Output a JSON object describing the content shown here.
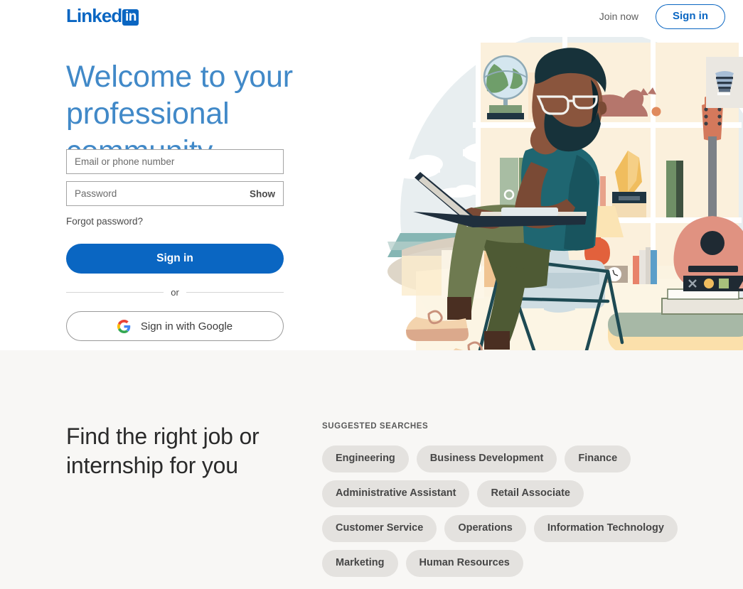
{
  "header": {
    "logo_text": "Linked",
    "logo_badge": "in",
    "join_now": "Join now",
    "sign_in": "Sign in"
  },
  "hero": {
    "headline_line1": "Welcome to your",
    "headline_line2": "professional community",
    "email": {
      "value": "",
      "placeholder": "Email or phone number"
    },
    "password": {
      "value": "",
      "placeholder": "Password",
      "show_label": "Show"
    },
    "forgot_password": "Forgot password?",
    "sign_in_button": "Sign in",
    "divider_label": "or",
    "google_button": "Sign in with Google",
    "illustration": {
      "name": "person-reading-at-laptop-illustration",
      "elements": [
        "globe",
        "books",
        "cat",
        "binders",
        "vase",
        "lamp",
        "clocks",
        "guitar",
        "armchair",
        "laptop",
        "framed-art",
        "sofa",
        "book-stack"
      ]
    }
  },
  "lower": {
    "title_line1": "Find the right job or",
    "title_line2": "internship for you",
    "suggested_label": "SUGGESTED SEARCHES",
    "chips": [
      "Engineering",
      "Business Development",
      "Finance",
      "Administrative Assistant",
      "Retail Associate",
      "Customer Service",
      "Operations",
      "Information Technology",
      "Marketing",
      "Human Resources"
    ]
  },
  "colors": {
    "brand_blue": "#0a66c2",
    "headline_blue": "#4189c8",
    "lower_bg": "#f8f7f5",
    "chip_bg": "#e4e2df"
  }
}
